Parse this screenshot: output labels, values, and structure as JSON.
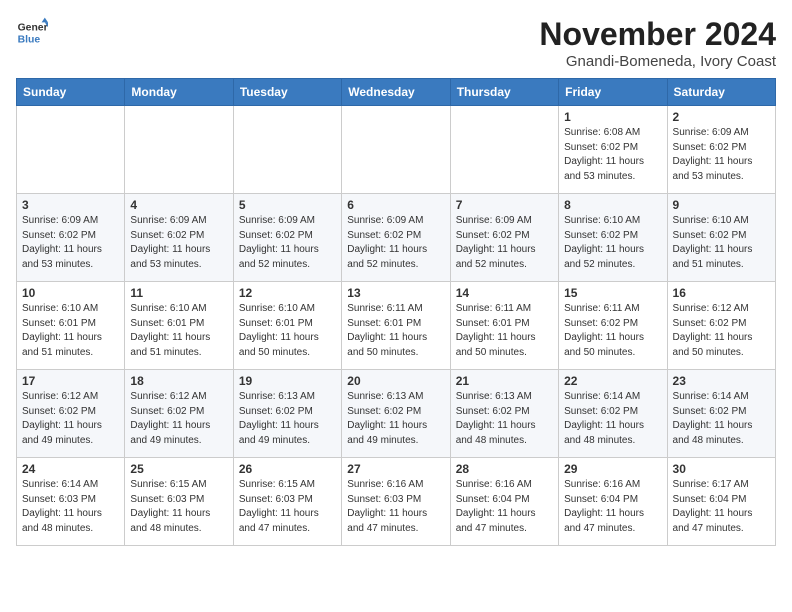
{
  "logo": {
    "line1": "General",
    "line2": "Blue"
  },
  "title": "November 2024",
  "subtitle": "Gnandi-Bomeneda, Ivory Coast",
  "days_of_week": [
    "Sunday",
    "Monday",
    "Tuesday",
    "Wednesday",
    "Thursday",
    "Friday",
    "Saturday"
  ],
  "weeks": [
    [
      {
        "day": "",
        "info": ""
      },
      {
        "day": "",
        "info": ""
      },
      {
        "day": "",
        "info": ""
      },
      {
        "day": "",
        "info": ""
      },
      {
        "day": "",
        "info": ""
      },
      {
        "day": "1",
        "info": "Sunrise: 6:08 AM\nSunset: 6:02 PM\nDaylight: 11 hours\nand 53 minutes."
      },
      {
        "day": "2",
        "info": "Sunrise: 6:09 AM\nSunset: 6:02 PM\nDaylight: 11 hours\nand 53 minutes."
      }
    ],
    [
      {
        "day": "3",
        "info": "Sunrise: 6:09 AM\nSunset: 6:02 PM\nDaylight: 11 hours\nand 53 minutes."
      },
      {
        "day": "4",
        "info": "Sunrise: 6:09 AM\nSunset: 6:02 PM\nDaylight: 11 hours\nand 53 minutes."
      },
      {
        "day": "5",
        "info": "Sunrise: 6:09 AM\nSunset: 6:02 PM\nDaylight: 11 hours\nand 52 minutes."
      },
      {
        "day": "6",
        "info": "Sunrise: 6:09 AM\nSunset: 6:02 PM\nDaylight: 11 hours\nand 52 minutes."
      },
      {
        "day": "7",
        "info": "Sunrise: 6:09 AM\nSunset: 6:02 PM\nDaylight: 11 hours\nand 52 minutes."
      },
      {
        "day": "8",
        "info": "Sunrise: 6:10 AM\nSunset: 6:02 PM\nDaylight: 11 hours\nand 52 minutes."
      },
      {
        "day": "9",
        "info": "Sunrise: 6:10 AM\nSunset: 6:02 PM\nDaylight: 11 hours\nand 51 minutes."
      }
    ],
    [
      {
        "day": "10",
        "info": "Sunrise: 6:10 AM\nSunset: 6:01 PM\nDaylight: 11 hours\nand 51 minutes."
      },
      {
        "day": "11",
        "info": "Sunrise: 6:10 AM\nSunset: 6:01 PM\nDaylight: 11 hours\nand 51 minutes."
      },
      {
        "day": "12",
        "info": "Sunrise: 6:10 AM\nSunset: 6:01 PM\nDaylight: 11 hours\nand 50 minutes."
      },
      {
        "day": "13",
        "info": "Sunrise: 6:11 AM\nSunset: 6:01 PM\nDaylight: 11 hours\nand 50 minutes."
      },
      {
        "day": "14",
        "info": "Sunrise: 6:11 AM\nSunset: 6:01 PM\nDaylight: 11 hours\nand 50 minutes."
      },
      {
        "day": "15",
        "info": "Sunrise: 6:11 AM\nSunset: 6:02 PM\nDaylight: 11 hours\nand 50 minutes."
      },
      {
        "day": "16",
        "info": "Sunrise: 6:12 AM\nSunset: 6:02 PM\nDaylight: 11 hours\nand 50 minutes."
      }
    ],
    [
      {
        "day": "17",
        "info": "Sunrise: 6:12 AM\nSunset: 6:02 PM\nDaylight: 11 hours\nand 49 minutes."
      },
      {
        "day": "18",
        "info": "Sunrise: 6:12 AM\nSunset: 6:02 PM\nDaylight: 11 hours\nand 49 minutes."
      },
      {
        "day": "19",
        "info": "Sunrise: 6:13 AM\nSunset: 6:02 PM\nDaylight: 11 hours\nand 49 minutes."
      },
      {
        "day": "20",
        "info": "Sunrise: 6:13 AM\nSunset: 6:02 PM\nDaylight: 11 hours\nand 49 minutes."
      },
      {
        "day": "21",
        "info": "Sunrise: 6:13 AM\nSunset: 6:02 PM\nDaylight: 11 hours\nand 48 minutes."
      },
      {
        "day": "22",
        "info": "Sunrise: 6:14 AM\nSunset: 6:02 PM\nDaylight: 11 hours\nand 48 minutes."
      },
      {
        "day": "23",
        "info": "Sunrise: 6:14 AM\nSunset: 6:02 PM\nDaylight: 11 hours\nand 48 minutes."
      }
    ],
    [
      {
        "day": "24",
        "info": "Sunrise: 6:14 AM\nSunset: 6:03 PM\nDaylight: 11 hours\nand 48 minutes."
      },
      {
        "day": "25",
        "info": "Sunrise: 6:15 AM\nSunset: 6:03 PM\nDaylight: 11 hours\nand 48 minutes."
      },
      {
        "day": "26",
        "info": "Sunrise: 6:15 AM\nSunset: 6:03 PM\nDaylight: 11 hours\nand 47 minutes."
      },
      {
        "day": "27",
        "info": "Sunrise: 6:16 AM\nSunset: 6:03 PM\nDaylight: 11 hours\nand 47 minutes."
      },
      {
        "day": "28",
        "info": "Sunrise: 6:16 AM\nSunset: 6:04 PM\nDaylight: 11 hours\nand 47 minutes."
      },
      {
        "day": "29",
        "info": "Sunrise: 6:16 AM\nSunset: 6:04 PM\nDaylight: 11 hours\nand 47 minutes."
      },
      {
        "day": "30",
        "info": "Sunrise: 6:17 AM\nSunset: 6:04 PM\nDaylight: 11 hours\nand 47 minutes."
      }
    ]
  ]
}
